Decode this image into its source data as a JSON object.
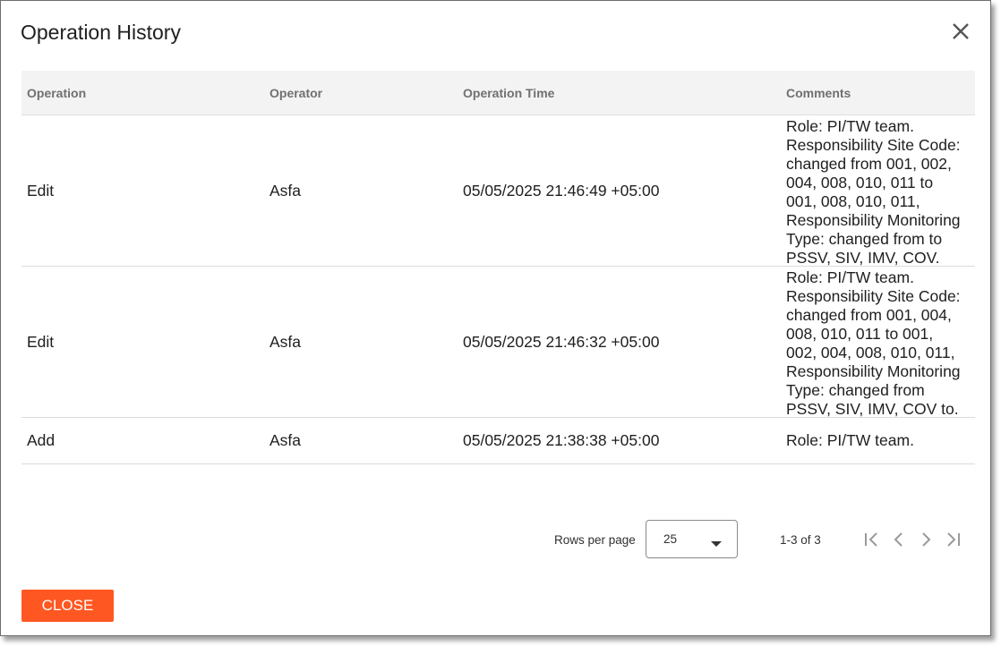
{
  "dialog": {
    "title": "Operation History",
    "close_button_label": "CLOSE",
    "accent_color": "#ff5722"
  },
  "table": {
    "columns": [
      "Operation",
      "Operator",
      "Operation Time",
      "Comments"
    ],
    "rows": [
      {
        "operation": "Edit",
        "operator": "Asfa",
        "time": "05/05/2025 21:46:49 +05:00",
        "comment_lines": [
          "Role: PI/TW team.",
          "Responsibility Site Code:",
          "changed from 001, 002,",
          "004, 008, 010, 011 to",
          "001, 008, 010, 011,",
          "Responsibility Monitoring",
          "Type: changed from to",
          "PSSV, SIV, IMV, COV."
        ]
      },
      {
        "operation": "Edit",
        "operator": "Asfa",
        "time": "05/05/2025 21:46:32 +05:00",
        "comment_lines": [
          "Role: PI/TW team.",
          "Responsibility Site Code:",
          "changed from 001, 004,",
          "008, 010, 011 to 001,",
          "002, 004, 008, 010, 011,",
          "Responsibility Monitoring",
          "Type: changed from",
          "PSSV, SIV, IMV, COV to."
        ]
      },
      {
        "operation": "Add",
        "operator": "Asfa",
        "time": "05/05/2025 21:38:38 +05:00",
        "comment_lines": [
          "Role: PI/TW team."
        ]
      }
    ]
  },
  "pagination": {
    "rows_per_page_label": "Rows per page",
    "rows_per_page_value": "25",
    "range_text": "1-3 of 3",
    "icons": [
      "first-page-icon",
      "previous-page-icon",
      "next-page-icon",
      "last-page-icon"
    ]
  }
}
